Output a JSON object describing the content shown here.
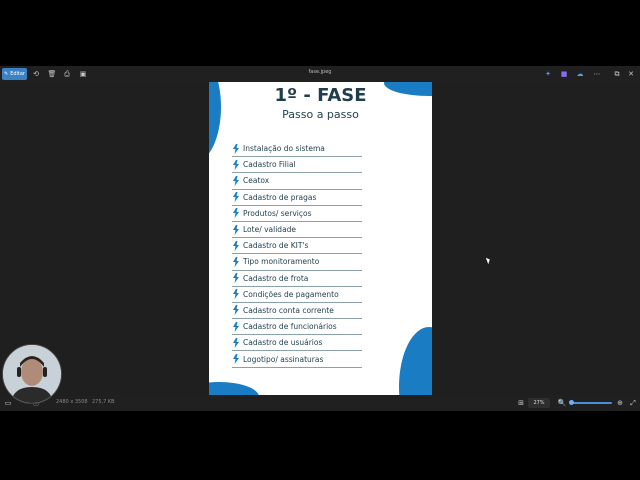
{
  "window": {
    "title": "fase.jpeg"
  },
  "toolbar": {
    "edit_label": "Editar",
    "icons": [
      "edit-icon",
      "rotate-icon",
      "delete-icon",
      "print-icon",
      "save-icon"
    ],
    "right_icons": [
      "copilot-icon",
      "teams-icon",
      "cloud-icon",
      "more-icon",
      "minimize-icon",
      "maximize-icon",
      "close-icon"
    ]
  },
  "document": {
    "title": "1º - FASE",
    "subtitle": "Passo a passo",
    "accent_color": "#1a7cc2",
    "items": [
      {
        "label": "Instalação do sistema"
      },
      {
        "label": "Cadastro Filial"
      },
      {
        "label": "Ceatox"
      },
      {
        "label": "Cadastro de pragas"
      },
      {
        "label": "Produtos/ serviços"
      },
      {
        "label": "Lote/ validade"
      },
      {
        "label": "Cadastro de KIT's"
      },
      {
        "label": "Tipo monitoramento"
      },
      {
        "label": "Cadastro de frota"
      },
      {
        "label": "Condições de pagamento"
      },
      {
        "label": "Cadastro conta corrente"
      },
      {
        "label": "Cadastro de funcionários"
      },
      {
        "label": "Cadastro de usuários"
      },
      {
        "label": "Logotipo/ assinaturas"
      }
    ]
  },
  "statusbar": {
    "dimensions": "2480 x 3508",
    "size": "275,7 KB",
    "zoom": "27%"
  }
}
